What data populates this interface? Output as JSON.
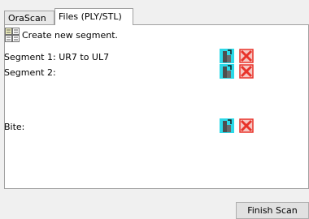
{
  "tabs": [
    {
      "label": "OraScan",
      "active": false
    },
    {
      "label": "Files (PLY/STL)",
      "active": true
    }
  ],
  "create_segment": {
    "label": "Create new segment.",
    "icon": "segment-grid-icon"
  },
  "segments": [
    {
      "label": "Segment 1: UR7 to UL7",
      "scan_icon": "scan-tooth-icon",
      "delete_icon": "delete-x-icon"
    },
    {
      "label": "Segment 2:",
      "scan_icon": "scan-tooth-icon",
      "delete_icon": "delete-x-icon"
    },
    {
      "label": "Bite:",
      "scan_icon": "scan-tooth-icon",
      "delete_icon": "delete-x-icon"
    }
  ],
  "footer": {
    "finish_label": "Finish Scan"
  },
  "colors": {
    "scan_cyan": "#2bd9e8",
    "delete_red": "#e8332a",
    "panel_bg": "#ffffff",
    "window_bg": "#f0f0f0"
  }
}
